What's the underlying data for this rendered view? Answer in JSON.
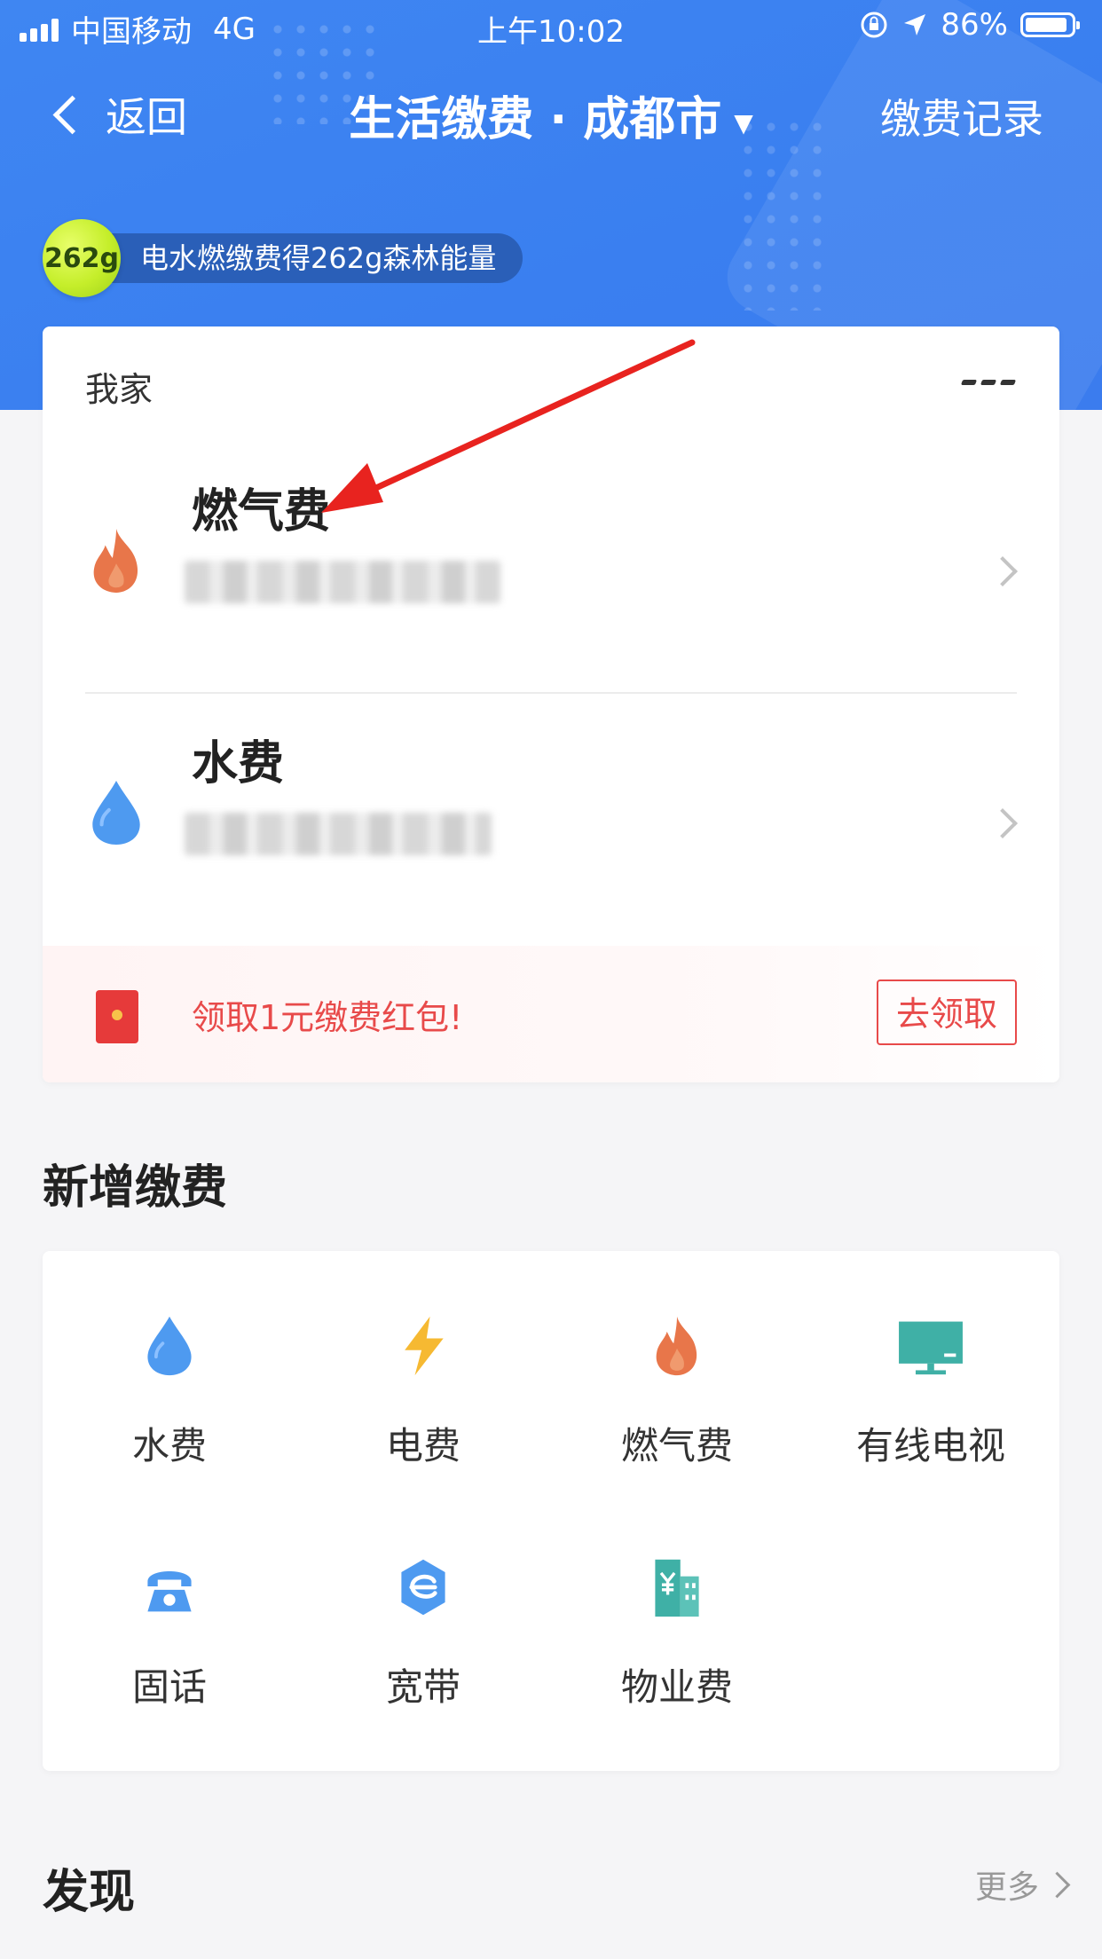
{
  "status_bar": {
    "carrier": "中国移动",
    "network": "4G",
    "time": "上午10:02",
    "battery": "86%"
  },
  "nav": {
    "back_label": "返回",
    "title": "生活缴费 · 成都市",
    "record_label": "缴费记录"
  },
  "energy": {
    "badge": "262g",
    "text": "电水燃缴费得262g森林能量"
  },
  "home": {
    "label": "我家",
    "bills": [
      {
        "name": "燃气费",
        "icon": "flame-icon",
        "account": "██████ ██████ ████"
      },
      {
        "name": "水费",
        "icon": "water-drop-icon",
        "account": "███████ ████ | ████"
      }
    ],
    "promo": {
      "text": "领取1元缴费红包!",
      "button": "去领取"
    }
  },
  "add": {
    "title": "新增缴费",
    "items": [
      {
        "label": "水费",
        "icon": "water-drop-icon"
      },
      {
        "label": "电费",
        "icon": "lightning-icon"
      },
      {
        "label": "燃气费",
        "icon": "flame-icon"
      },
      {
        "label": "有线电视",
        "icon": "tv-icon"
      },
      {
        "label": "固话",
        "icon": "telephone-icon"
      },
      {
        "label": "宽带",
        "icon": "broadband-icon"
      },
      {
        "label": "物业费",
        "icon": "building-icon"
      }
    ]
  },
  "discover": {
    "title": "发现",
    "more_label": "更多"
  },
  "colors": {
    "header_blue": "#3d82f1",
    "flame": "#e8764a",
    "water": "#4e9af0",
    "lightning": "#f6b932",
    "teal": "#3fb0a6",
    "promo_red": "#e84a4a",
    "annotation_arrow": "#e8231f"
  }
}
